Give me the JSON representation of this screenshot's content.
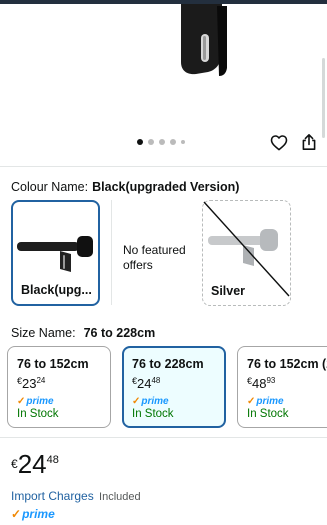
{
  "product_image": {
    "alt": "Curtain rod bracket"
  },
  "carousel": {
    "dots": 5,
    "active_index": 0
  },
  "actions": {
    "wishlist_icon": "heart-icon",
    "share_icon": "share-icon"
  },
  "colour": {
    "label": "Colour Name:",
    "value": "Black(upgraded Version)",
    "options": [
      {
        "label": "Black(upg...",
        "selected": true
      },
      {
        "label": "No featured offers"
      },
      {
        "label": "Silver",
        "unavailable": true
      }
    ]
  },
  "size": {
    "label": "Size Name:",
    "value": "76 to 228cm",
    "options": [
      {
        "title": "76 to 152cm",
        "currency": "€",
        "whole": "23",
        "cents": "24",
        "prime": "prime",
        "stock": "In Stock"
      },
      {
        "title": "76 to 228cm",
        "currency": "€",
        "whole": "24",
        "cents": "48",
        "prime": "prime",
        "stock": "In Stock"
      },
      {
        "title": "76 to 152cm (2",
        "currency": "€",
        "whole": "48",
        "cents": "93",
        "prime": "prime",
        "stock": "In Stock"
      }
    ]
  },
  "price": {
    "currency": "€",
    "whole": "24",
    "cents": "48"
  },
  "import_charges": {
    "link": "Import Charges",
    "suffix": "Included"
  },
  "prime_badge": {
    "label": "prime"
  },
  "colors": {
    "accent": "#2162a1",
    "prime_blue": "#1a98ff",
    "stock_green": "#007600",
    "prime_check": "#f08804"
  }
}
